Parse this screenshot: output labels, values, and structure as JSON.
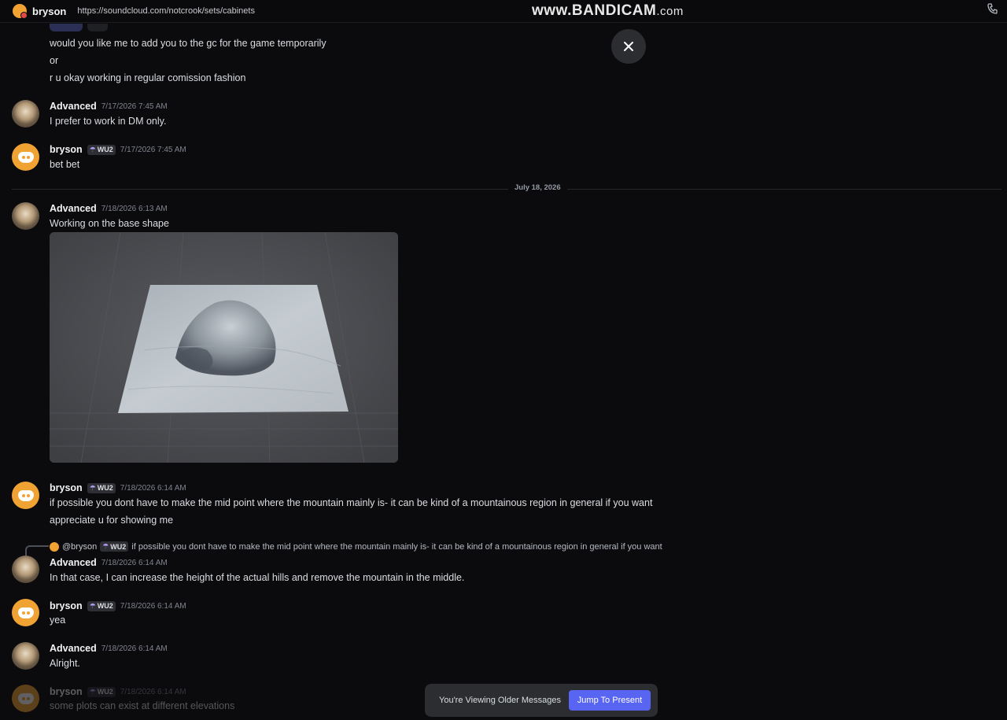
{
  "topbar": {
    "name": "bryson",
    "status": "https://soundcloud.com/notcrook/sets/cabinets",
    "watermark_main": "www.BANDICAM",
    "watermark_suffix": ".com"
  },
  "date_divider": "July 18, 2026",
  "continued_lines": [
    "would you like me to add you to the gc for the game temporarily",
    "or",
    "r u okay working in regular comission fashion"
  ],
  "tag_label": "WU2",
  "messages": [
    {
      "author": "Advanced",
      "timestamp": "7/17/2026 7:45 AM",
      "text": "I prefer to work in DM only."
    },
    {
      "author": "bryson",
      "timestamp": "7/17/2026 7:45 AM",
      "text": "bet bet"
    },
    {
      "author": "Advanced",
      "timestamp": "7/18/2026 6:13 AM",
      "text": "Working on the base shape"
    },
    {
      "author": "bryson",
      "timestamp": "7/18/2026 6:14 AM",
      "text": "if possible you dont have to make the mid point where the mountain mainly is- it can be kind of a mountainous region in general if you want",
      "text2": "appreciate u for showing me"
    },
    {
      "author": "Advanced",
      "timestamp": "7/18/2026 6:14 AM",
      "text": "In that case, I can increase the height of the actual hills and remove the mountain in the middle."
    },
    {
      "author": "bryson",
      "timestamp": "7/18/2026 6:14 AM",
      "text": "yea"
    },
    {
      "author": "Advanced",
      "timestamp": "7/18/2026 6:14 AM",
      "text": "Alright."
    },
    {
      "author": "bryson",
      "timestamp": "7/18/2026 6:14 AM",
      "text": "some plots can exist at different elevations"
    }
  ],
  "reply": {
    "mention": "@bryson",
    "text": "if possible you dont have to make the mid point where the mountain mainly is- it can be kind of a mountainous region in general if you want"
  },
  "bottom_bar": {
    "notice": "You're Viewing Older Messages",
    "jump_label": "Jump To Present"
  },
  "colors": {
    "background": "#0b0b0e",
    "accent": "#5865f2",
    "discord_avatar": "#f0a232"
  }
}
